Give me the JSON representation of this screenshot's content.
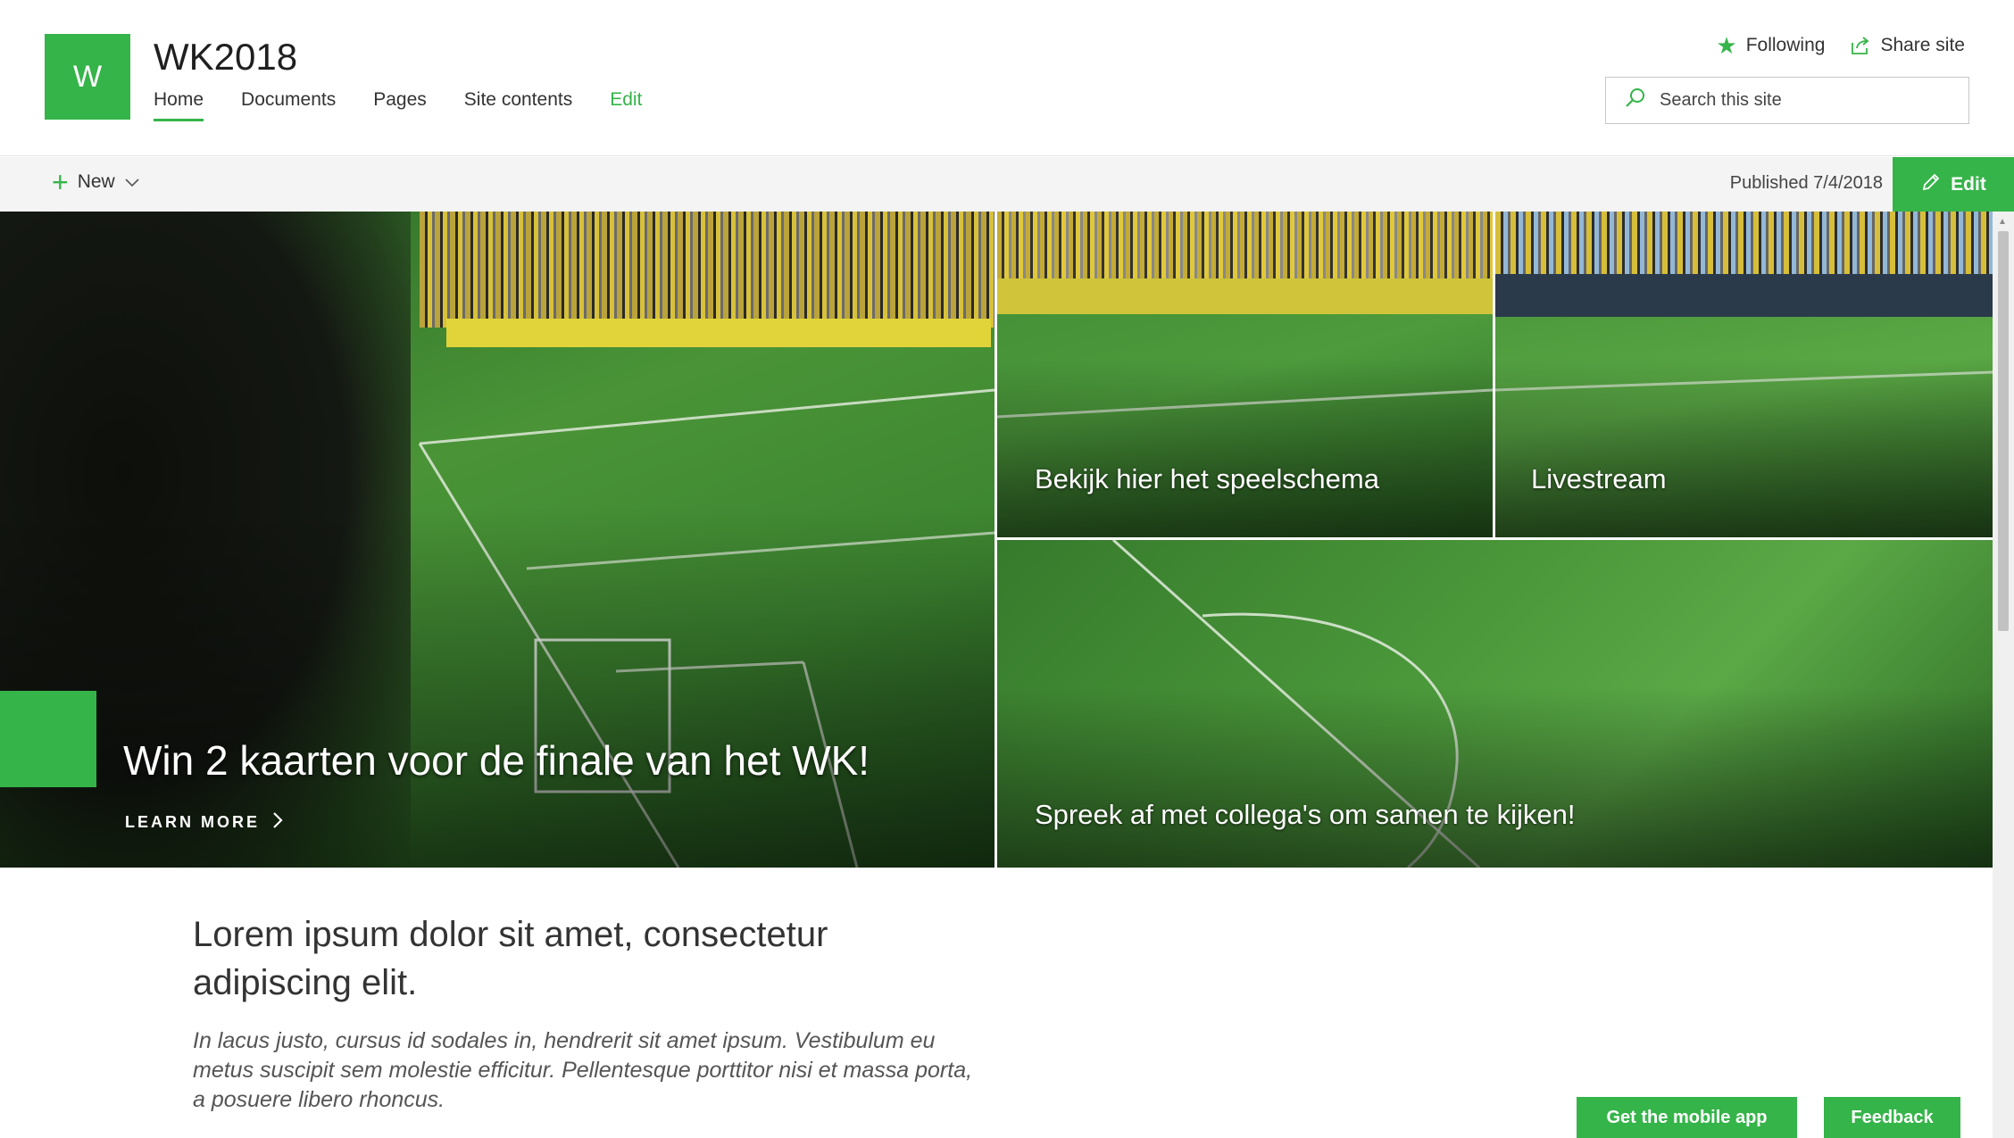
{
  "site": {
    "logo_letter": "W",
    "title": "WK2018"
  },
  "nav": {
    "items": [
      {
        "label": "Home",
        "active": true
      },
      {
        "label": "Documents"
      },
      {
        "label": "Pages"
      },
      {
        "label": "Site contents"
      }
    ],
    "edit_label": "Edit"
  },
  "actions": {
    "following_label": "Following",
    "share_label": "Share site"
  },
  "search": {
    "placeholder": "Search this site"
  },
  "command_bar": {
    "new_label": "New",
    "published_label": "Published 7/4/2018",
    "edit_label": "Edit"
  },
  "hero": {
    "main": {
      "title": "Win 2 kaarten voor de finale van het WK!",
      "link_label": "LEARN MORE"
    },
    "tile_1": {
      "label": "Bekijk hier het speelschema"
    },
    "tile_2": {
      "label": "Livestream"
    },
    "tile_3": {
      "label": "Spreek af met collega's om samen te kijken!"
    }
  },
  "content": {
    "heading": "Lorem ipsum dolor sit amet, consectetur adipiscing elit.",
    "body": "In lacus justo, cursus id sodales in, hendrerit sit amet ipsum. Vestibulum eu metus suscipit sem molestie efficitur. Pellentesque porttitor nisi et massa porta, a posuere libero rhoncus."
  },
  "footer": {
    "mobile_app_label": "Get the mobile app",
    "feedback_label": "Feedback"
  },
  "colors": {
    "accent": "#35b449",
    "pitch_light": "#4f9a3a",
    "pitch_dark": "#2f6e26",
    "crowd_yellow": "#d8c13a"
  }
}
